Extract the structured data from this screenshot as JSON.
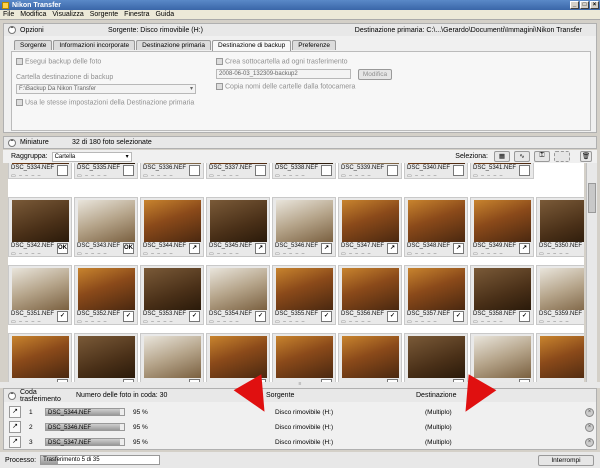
{
  "window": {
    "title": "Nikon Transfer"
  },
  "menu": [
    "File",
    "Modifica",
    "Visualizza",
    "Sorgente",
    "Finestra",
    "Guida"
  ],
  "options": {
    "header": "Opzioni",
    "source_label": "Sorgente: Disco rimovibile (H:)",
    "dest_label": "Destinazione primaria: C:\\...\\Gerardo\\Documenti\\Immagini\\Nikon Transfer",
    "tabs": [
      "Sorgente",
      "Informazioni incorporate",
      "Destinazione primaria",
      "Destinazione di backup",
      "Preferenze"
    ],
    "active_tab": 3,
    "backup_check": "Esegui backup delle foto",
    "backup_folder_label": "Cartella destinazione di backup",
    "backup_folder_value": "F:\\Backup Da Nikon Transfer",
    "same_settings": "Usa le stesse impostazioni della Destinazione primaria",
    "create_subfolder": "Crea sottocartella ad ogni trasferimento",
    "subfolder_value": "2008-06-03_132309-backup2",
    "modify_button": "Modifica",
    "copy_names": "Copia nomi delle cartelle dalla fotocamera"
  },
  "thumbs": {
    "header": "Miniature",
    "selected_count": "32 di 180 foto selezionate",
    "group_label": "Raggruppa:",
    "group_value": "Cartella",
    "select_label": "Seleziona:",
    "rows": [
      {
        "names": [
          "DSC_5334.NEF",
          "DSC_5335.NEF",
          "DSC_5336.NEF",
          "DSC_5337.NEF",
          "DSC_5338.NEF",
          "DSC_5339.NEF",
          "DSC_5340.NEF",
          "DSC_5341.NEF"
        ],
        "marks": [
          "",
          "",
          "",
          "",
          "",
          "",
          "",
          ""
        ]
      },
      {
        "names": [
          "DSC_5342.NEF",
          "DSC_5343.NEF",
          "DSC_5344.NEF",
          "DSC_5345.NEF",
          "DSC_5346.NEF",
          "DSC_5347.NEF",
          "DSC_5348.NEF",
          "DSC_5349.NEF",
          "DSC_5350.NEF"
        ],
        "marks": [
          "OK",
          "OK",
          "↗",
          "↗",
          "↗",
          "↗",
          "↗",
          "↗",
          "↗"
        ]
      },
      {
        "names": [
          "DSC_5351.NEF",
          "DSC_5352.NEF",
          "DSC_5353.NEF",
          "DSC_5354.NEF",
          "DSC_5355.NEF",
          "DSC_5356.NEF",
          "DSC_5357.NEF",
          "DSC_5358.NEF",
          "DSC_5359.NEF"
        ],
        "marks": [
          "✓",
          "✓",
          "✓",
          "✓",
          "✓",
          "✓",
          "✓",
          "✓",
          "✓"
        ]
      },
      {
        "names": [
          "",
          "",
          "",
          "",
          "",
          "",
          "",
          "",
          ""
        ],
        "marks": [
          "",
          "",
          "",
          "",
          "",
          "",
          "",
          "",
          ""
        ]
      }
    ]
  },
  "queue": {
    "header": "Coda trasferimento",
    "count_label": "Numero delle foto in coda: 30",
    "col_source": "Sorgente",
    "col_dest": "Destinazione",
    "items": [
      {
        "num": "1",
        "file": "DSC_5344.NEF",
        "pct": "95 %",
        "progress": 0.95,
        "source": "Disco rimovibile (H:)",
        "dest": "(Multiplo)"
      },
      {
        "num": "2",
        "file": "DSC_5346.NEF",
        "pct": "95 %",
        "progress": 0.95,
        "source": "Disco rimovibile (H:)",
        "dest": "(Multiplo)"
      },
      {
        "num": "3",
        "file": "DSC_5347.NEF",
        "pct": "95 %",
        "progress": 0.95,
        "source": "Disco rimovibile (H:)",
        "dest": "(Multiplo)"
      }
    ]
  },
  "status": {
    "label": "Processo:",
    "progress_text": "Trasferimento 5 di 35",
    "progress": 0.14,
    "stop_button": "Interrompi"
  },
  "colors": {
    "arrow": "#e01010",
    "accent": "#3a66a8"
  }
}
